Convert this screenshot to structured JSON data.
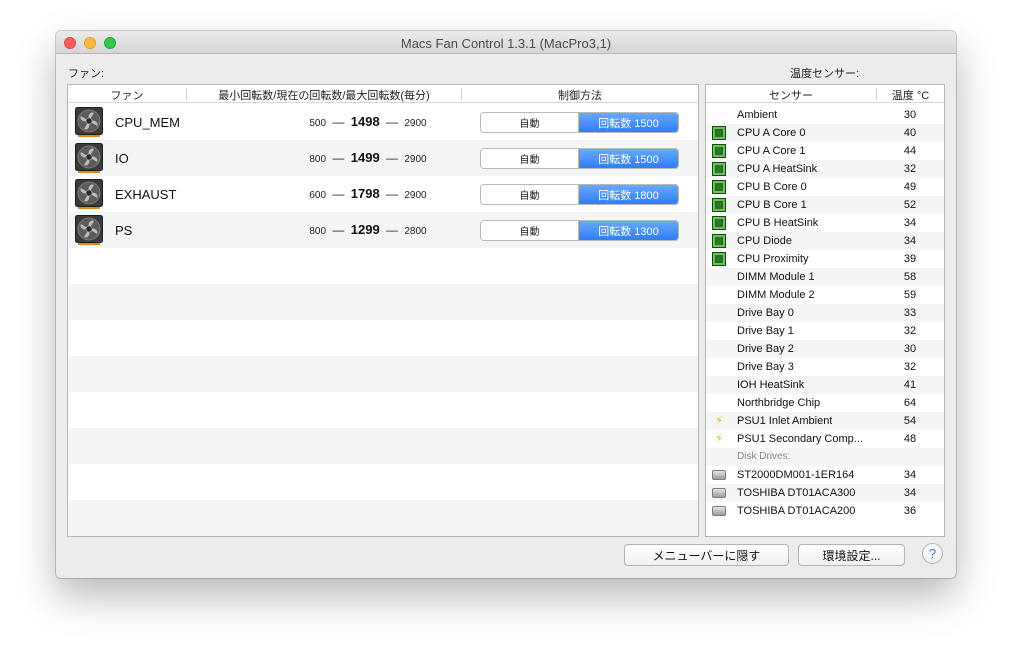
{
  "window": {
    "title": "Macs Fan Control 1.3.1 (MacPro3,1)"
  },
  "fans_label": "ファン:",
  "sensors_label": "温度センサー:",
  "fan_table": {
    "col_fan": "ファン",
    "col_rpm": "最小回転数/現在の回転数/最大回転数(毎分)",
    "col_control": "制御方法",
    "dash": "—",
    "auto_label": "自動",
    "rows": [
      {
        "name": "CPU_MEM",
        "min": "500",
        "current": "1498",
        "max": "2900",
        "control": "回転数 1500"
      },
      {
        "name": "IO",
        "min": "800",
        "current": "1499",
        "max": "2900",
        "control": "回転数 1500"
      },
      {
        "name": "EXHAUST",
        "min": "600",
        "current": "1798",
        "max": "2900",
        "control": "回転数 1800"
      },
      {
        "name": "PS",
        "min": "800",
        "current": "1299",
        "max": "2800",
        "control": "回転数 1300"
      }
    ]
  },
  "sensor_table": {
    "col_sensor": "センサー",
    "col_temp": "温度 °C",
    "rows": [
      {
        "kind": "sensor",
        "icon": "none",
        "name": "Ambient",
        "value": "30"
      },
      {
        "kind": "sensor",
        "icon": "chip-icon",
        "name": "CPU A Core 0",
        "value": "40"
      },
      {
        "kind": "sensor",
        "icon": "chip-icon",
        "name": "CPU A Core 1",
        "value": "44"
      },
      {
        "kind": "sensor",
        "icon": "chip-icon",
        "name": "CPU A HeatSink",
        "value": "32"
      },
      {
        "kind": "sensor",
        "icon": "chip-icon",
        "name": "CPU B Core 0",
        "value": "49"
      },
      {
        "kind": "sensor",
        "icon": "chip-icon",
        "name": "CPU B Core 1",
        "value": "52"
      },
      {
        "kind": "sensor",
        "icon": "chip-icon",
        "name": "CPU B HeatSink",
        "value": "34"
      },
      {
        "kind": "sensor",
        "icon": "chip-icon",
        "name": "CPU Diode",
        "value": "34"
      },
      {
        "kind": "sensor",
        "icon": "chip-icon",
        "name": "CPU Proximity",
        "value": "39"
      },
      {
        "kind": "sensor",
        "icon": "none",
        "name": "DIMM Module 1",
        "value": "58"
      },
      {
        "kind": "sensor",
        "icon": "none",
        "name": "DIMM Module 2",
        "value": "59"
      },
      {
        "kind": "sensor",
        "icon": "none",
        "name": "Drive Bay 0",
        "value": "33"
      },
      {
        "kind": "sensor",
        "icon": "none",
        "name": "Drive Bay 1",
        "value": "32"
      },
      {
        "kind": "sensor",
        "icon": "none",
        "name": "Drive Bay 2",
        "value": "30"
      },
      {
        "kind": "sensor",
        "icon": "none",
        "name": "Drive Bay 3",
        "value": "32"
      },
      {
        "kind": "sensor",
        "icon": "none",
        "name": "IOH HeatSink",
        "value": "41"
      },
      {
        "kind": "sensor",
        "icon": "none",
        "name": "Northbridge Chip",
        "value": "64"
      },
      {
        "kind": "sensor",
        "icon": "bolt-icon",
        "name": "PSU1 Inlet Ambient",
        "value": "54"
      },
      {
        "kind": "sensor",
        "icon": "bolt-icon",
        "name": "PSU1 Secondary Comp...",
        "value": "48"
      },
      {
        "kind": "group",
        "name": "Disk Drives:"
      },
      {
        "kind": "sensor",
        "icon": "disk-icon",
        "name": "ST2000DM001-1ER164",
        "value": "34"
      },
      {
        "kind": "sensor",
        "icon": "disk-icon",
        "name": "TOSHIBA DT01ACA300",
        "value": "34"
      },
      {
        "kind": "sensor",
        "icon": "disk-icon",
        "name": "TOSHIBA DT01ACA200",
        "value": "36"
      }
    ]
  },
  "buttons": {
    "hide_menubar": "メニューバーに隠す",
    "preferences": "環境設定...",
    "help": "?"
  },
  "colors": {
    "accent_blue": "#2d7ef6",
    "stripe": "#f4f5f5",
    "chip_green": "#2c7a2c",
    "bolt_yellow": "#e3b300"
  }
}
